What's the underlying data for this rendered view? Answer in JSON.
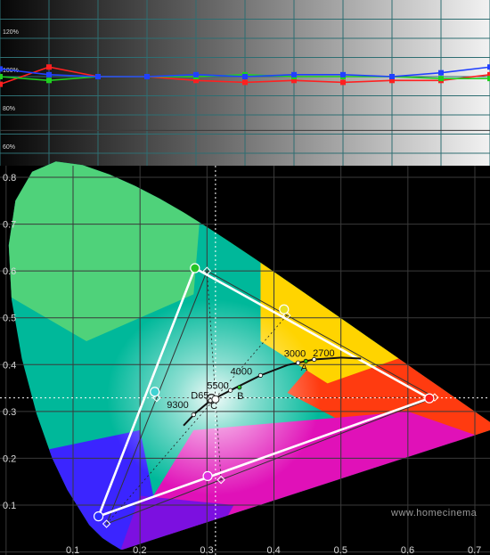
{
  "chart_data": [
    {
      "type": "line",
      "title": "",
      "ylabel": "",
      "ylim": [
        50,
        130
      ],
      "y_tick_labels": [
        "120%",
        "100%",
        "80%",
        "60%"
      ],
      "y_ticks": [
        120,
        100,
        80,
        60
      ],
      "x": [
        0,
        10,
        20,
        30,
        40,
        50,
        60,
        70,
        80,
        90,
        100
      ],
      "grid": true,
      "background": "grayscale-ramp",
      "series": [
        {
          "color": "#ff2020",
          "values": [
            96,
            105,
            100,
            100,
            98,
            97,
            98,
            97,
            98,
            98,
            101
          ]
        },
        {
          "color": "#20d020",
          "values": [
            100,
            98,
            100,
            100,
            100,
            101,
            100,
            100,
            100,
            99,
            99
          ]
        },
        {
          "color": "#2040ff",
          "values": [
            104,
            101,
            100,
            100,
            101,
            100,
            101,
            101,
            100,
            102,
            105
          ]
        }
      ]
    },
    {
      "type": "scatter",
      "title": "",
      "xlabel": "",
      "ylabel": "",
      "xlim": [
        0,
        0.75
      ],
      "ylim": [
        0,
        0.85
      ],
      "x_tick_labels": [
        "0.1",
        "0.2",
        "0.3",
        "0.4",
        "0.5",
        "0.6",
        "0.7"
      ],
      "y_tick_labels": [
        "0.1",
        "0.2",
        "0.3",
        "0.4",
        "0.5",
        "0.6",
        "0.7",
        "0.8"
      ],
      "grid": true,
      "reference_gamut": [
        [
          0.64,
          0.33
        ],
        [
          0.3,
          0.6
        ],
        [
          0.15,
          0.06
        ]
      ],
      "measured_gamut": [
        [
          0.632,
          0.328
        ],
        [
          0.282,
          0.606
        ],
        [
          0.138,
          0.076
        ]
      ],
      "reference_secondaries": [
        [
          0.225,
          0.329
        ],
        [
          0.321,
          0.154
        ],
        [
          0.419,
          0.505
        ]
      ],
      "measured_secondaries": [
        [
          0.222,
          0.342
        ],
        [
          0.301,
          0.162
        ],
        [
          0.415,
          0.518
        ]
      ],
      "white_point": [
        0.3127,
        0.329
      ],
      "planckian_locus": [
        [
          0.265,
          0.27
        ],
        [
          0.283,
          0.297
        ],
        [
          0.305,
          0.323
        ],
        [
          0.335,
          0.345
        ],
        [
          0.38,
          0.377
        ],
        [
          0.42,
          0.399
        ],
        [
          0.46,
          0.411
        ],
        [
          0.5,
          0.415
        ],
        [
          0.53,
          0.413
        ]
      ],
      "cct_labels": [
        "2700",
        "3000",
        "4000",
        "5500",
        "D65",
        "9300",
        "A",
        "B",
        "C"
      ],
      "watermark": "www.homecinema"
    }
  ]
}
